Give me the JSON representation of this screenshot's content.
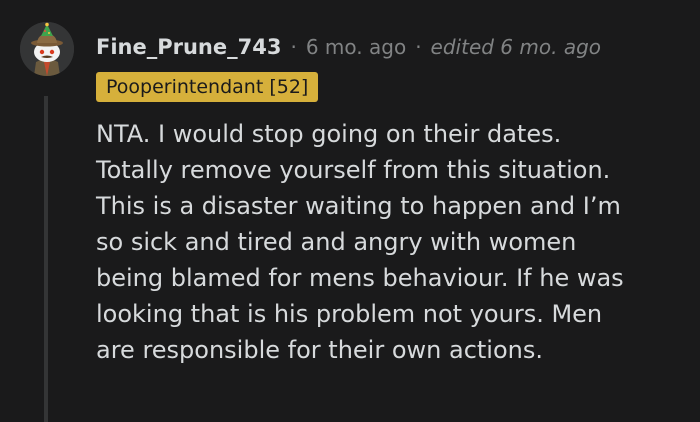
{
  "comment": {
    "author": "Fine_Prune_743",
    "separator": "·",
    "timestamp": "6 mo. ago",
    "edited": "edited 6 mo. ago",
    "flair": "Pooperintendant [52]",
    "body_lines": [
      "NTA. I would stop going on their dates.",
      "Totally remove yourself from this situation.",
      "This is a disaster waiting to happen and I’m",
      "so sick and tired and angry with women",
      "being blamed for mens behaviour. If he was",
      "looking that is his problem not yours. Men",
      "are responsible for their own actions."
    ]
  },
  "colors": {
    "background": "#1a1a1b",
    "text": "#d7dadc",
    "muted": "#818384",
    "flair_bg": "#d6b03b",
    "thread_line": "#343536"
  },
  "icons": {
    "avatar": "reddit-snoo-avatar-icon"
  }
}
